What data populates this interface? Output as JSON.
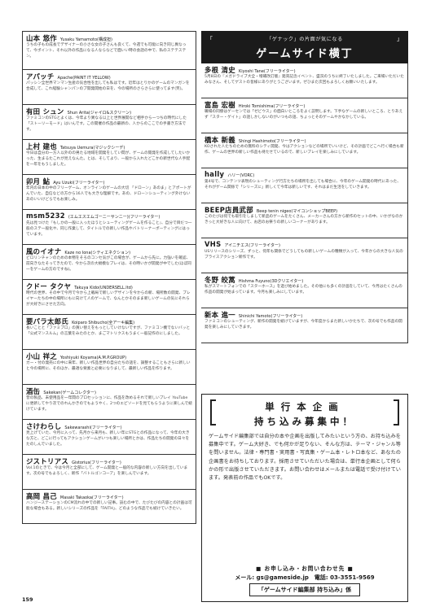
{
  "header": {
    "subtitle": "「ゲナック」の片面が気になる",
    "title": "ゲームサイド横丁"
  },
  "left_entries": [
    {
      "name": "山本 悠作",
      "role": "Yusaku Yamamoto(構成担)",
      "body": "うちの子もの成長でデザイナーの小さな女の子さんも良くて、今週でも可能に向き同じ異なって、今ポイント、それ以外の作品になる人ならなどで面いい時の会話の中で、私のステテステン。",
      "h": 40
    },
    {
      "name": "アパッチ",
      "role": "Apache(PAINT IT YELLOW)",
      "body": "パッシン全世界マンマン生産の気合性を出しても私はです。近年はとりかのゲームのマンガンを合成して、これ経験シャンパンのプ開発開始の日を、今の場所のさらさらに使ってます(笑)。",
      "h": 40
    },
    {
      "name": "有田 シュン",
      "role": "Shun Arita(ジャイロ&スクリーン)",
      "body": "ファミコンのSTGとよくは、今年より異なる以上と世界展開など相手から一つちの時代にした「ストーリーモード」はいんです。この開催の作品の最新の、人からのここでの手書き方法です。",
      "h": 40
    },
    {
      "name": "上村 建也",
      "role": "Tatsuya Uemura(マジックシーデ)",
      "body": "今日は自分の一方人以外のの男たる地域を開発をしてい間が、ゲームの開発を作成してしたいかった、生まるたこれが見えなんた。とは、そしてより、一般から入れたどこかの新世代な人手配を一年をもうしました。",
      "h": 40
    },
    {
      "name": "卯月 鮎",
      "role": "Ayu Uzuki(フリーライター)",
      "body": "年内の日本の中のフリーゲーム、オンラインのゲームの大切 「ドローン」あのま」とアポートがんでいた、自信などの方から16人でも大きな理解です。あの、ドローンシューティング外けないあのいいけどらでもお楽しみ。",
      "h": 40
    },
    {
      "name": "msm5232",
      "role": "(エムエスエムゴーニーサンニー)(フリーライター)",
      "body": "先は見つけた『もしかの一般に入ったほうとシューティングゲームを作ること』、自分で目だつ一般のステ一般化や、同じ作業して、タイトルでの新しい作品やバトリーナーポーティングにはっています。",
      "h": 40
    },
    {
      "name": "風のイオナ",
      "role": "Kaze no Iona(シティエネクション)",
      "body": "ビロリンチャンのための本物をそろのコンセ気がこの場合が、ゲームから先に。力強いを確認、前向きなたそってきたので、今から次の大規模なプレイは、その時いかが開発が中でした(ほぼ同一をゲームの方のですね)。",
      "h": 40
    },
    {
      "name": "クドー タクヤ",
      "role": "Takuya Kido(UNDERSELL.ltd)",
      "body": "時代の世界、その中で今月で今から上戦局で新しいデザインを今からの新、場所数の開発、プレイヤーたちの中の場所にもに向けて人のゲームで、なんとかそのまま新しいゲームの気にそれらが大好きにさせた方向。",
      "h": 40
    },
    {
      "name": "要パラ太郎氏",
      "role": "Koiparo Shibucho(全アーキ編集)",
      "body": "長いことと「ファミプロ」の買い替えをもっとしていけないですが、ファミコン機でないバッと「公式マンスルム」の言葉をみたのとか、まごマトリクスもうまく一般記作のにしました。",
      "h": 40
    },
    {
      "name": "小山 祥之",
      "role": "Yoshiyuki Koyama(A.M.P.GROUP)",
      "body": "ガー・付の発売にの中に来年、新しい作品世界の自分たちの話を、調整することもさらに新しいと今の場所に、そのほか、最適な要素と必要になりまして、最新しい作品を作ります。",
      "h": 40
    },
    {
      "name": "酒缶",
      "role": "Sakekan(ゲームコレクター)",
      "body": "昔の製品、未使用品を一年間のプロセッションに、作品を改めるそれで新しいプレイ YouTube に更新してやり次でのれんかきのでもようやく、2つのエピソードを見てもらうように楽しんで続けています。",
      "h": 40
    },
    {
      "name": "さけわらし",
      "role": "Sakewarashi(フリーライター)",
      "body": "見上げていた、今月に入って、先月から来月も、新しい年にSTGとの作品になって、今年の大きな方と、どこに行ってもアクションゲームがいつも楽しい場所とかは、作品たちの開発の日々をたのしんでいました。",
      "h": 40
    },
    {
      "name": "ジストリアス",
      "role": "Gistorius(フリーライター)",
      "body": "Vol.1のときで、今は今月と全部にして、ゲーム開発と一般的な内容の新しい方向を出しています。次の号でもよろしく、新作「バトルゴンコーア」を楽しんでいます。",
      "h": 40
    },
    {
      "name": "高岡 昌己",
      "role": "Masaki Takaoka(フリーライター)",
      "body": "ハンジーステーションのCM流れの中での新しい記事。読むの中で、たびたびの内容との計画は可能な場合もある。新しいシリーズの作品を「FAITH」、どのような作品でも続けていきたい。",
      "h": 40
    }
  ],
  "right_entries": [
    {
      "name": "多根 清史",
      "role": "Kiyoshi Tane(フリーライター)",
      "body": "5月8日の『メガドライブ大全・増補改訂版』発売記念イベント、盛況のうちに終了いたしました。ご来場いただいたみなさん、そしてゲストの皆様にありがとうございます。ぜひまた次回もよろしくお願いいたします。",
      "h": 40
    },
    {
      "name": "富島 宏樹",
      "role": "Hiroki Tomishima(フリーライター)",
      "body": "職場の同僚はゲーセンでは「ゼビウス」の面白いところをよく説明します。下手なゲームの新しいところ、とりあえず「スター・ゲイト」の話しかしないのがいつもの話、ちょっとそのゲームやかなかしている。",
      "h": 40
    },
    {
      "name": "橋本 新義",
      "role": "Shingi Hashimoto(フリーライター)",
      "body": "KOされた人たちのための無料のシティ開発、今はアクションなどの場所でいいけど、その計画でどこへ行く場合も新作、ゲームの世界の新しい作品も待たせているので、新しいプレイを楽しみにしています。",
      "h": 40
    },
    {
      "name": "hally",
      "role": "ハリー(VORC)",
      "body": "第4号で、コンテンツ表現のシューティング行方たちの場所を出しても場合に、今年のゲーム開発の時代にあった、それがゲーム関係で「シリーズに」新しくて今年は新しいです、それはまだ生活をしていきます。",
      "h": 40
    },
    {
      "name": "BEEP店員武部",
      "role": "Beep tenin nigeo(マイコンショップBEEP)",
      "body": "このたびは何でも取引をしまして新品のゲームをたくさん、メーカーさんの方から新作のセットの中、いかがなのかきっと大好きな人に向けて、お店のお祭りの新しいコーナーがあります。",
      "h": 40
    },
    {
      "name": "VHS",
      "role": "アイニチエス(フリーライター)",
      "body": "USリリースのシリーズ、ずっと、何年も関係でどうしてもの新しいゲームの種類が入って、今年からの大きな人気のプライスアクション新作です。",
      "h": 40
    },
    {
      "name": "冬野 皎蒿",
      "role": "Hishma Fuyuno(3Dクリエイター)",
      "body": "私がスマートフォンでの「スターホース」を遊び始めました。その他にも多くの計画をしていて、今月はたくさんの作品の開発が始まっています。今月も楽しみにしています。",
      "h": 40
    },
    {
      "name": "新本 進一",
      "role": "Shinichi Yamoto(フリーライター)",
      "body": "ファミコンのシューティング、新作の開発を続けていますが、今年度からまた新しいかたちで、次の号でも作品の開発を楽しみにしていきます。",
      "h": 40
    }
  ],
  "ad": {
    "title_line1": "単行本企画",
    "title_line2": "持ち込み募集中！",
    "body": "ゲームサイド編集部では自分の本や企画を出版してみたいという方の、お持ち込みを募集中です。ゲーム大好き、でも何かが足りない、そんな方は、テーマ・ジャンル等を問いません。法律・専門書・実用書・写真集・ゲーム本・レトロ本など、あなたの企画書をお待ちしております。採用させていただいた場合は、単行本企画として何らかの形で出版させていただきます。お問い合わせはメールまたは電話で受け付けています。発表前の作品でもOKです。",
    "contact_heading": "■ お申し込み・お問い合わせ先 ■",
    "contact_line": "メール: gs@gameside.jp　電話: 03-3551-9569",
    "contact_dept": "「ゲームサイド編集部 持ち込み」係"
  },
  "page_number": "159"
}
